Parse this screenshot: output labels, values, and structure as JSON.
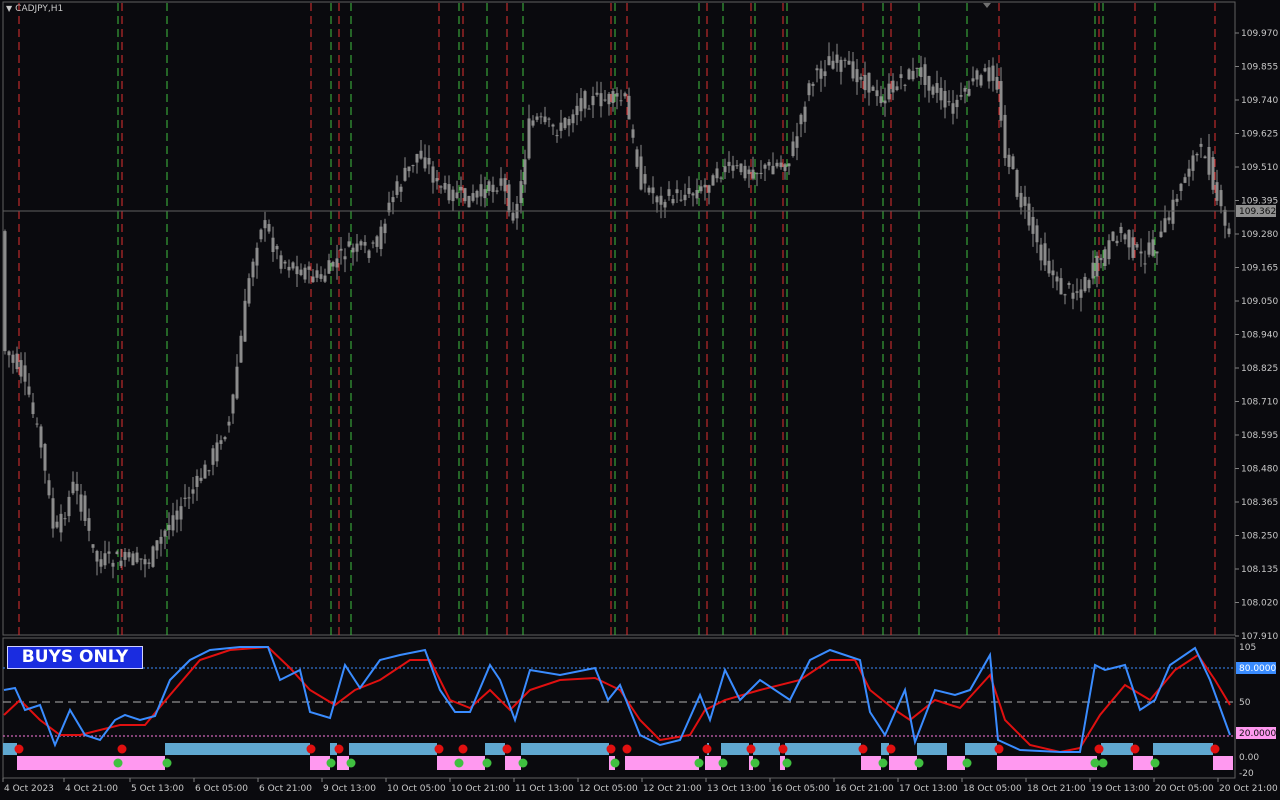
{
  "window": {
    "symbol_title": "CADJPY,H1",
    "dropdown_icon": "triangle-down-icon"
  },
  "price_panel": {
    "price_labels": [
      "109.970",
      "109.855",
      "109.740",
      "109.625",
      "109.510",
      "109.395",
      "109.280",
      "109.165",
      "109.050",
      "108.940",
      "108.825",
      "108.710",
      "108.595",
      "108.480",
      "108.365",
      "108.250",
      "108.135",
      "108.020",
      "107.910"
    ],
    "current_price": "109.362",
    "colors": {
      "candles": "#8c8c8c",
      "current_line": "#606060",
      "sell_line": "#e03030",
      "buy_line": "#40c040"
    }
  },
  "indicator_panel": {
    "badge": "BUYS ONLY",
    "scale_labels": [
      "105",
      "50",
      "0.00",
      "-20"
    ],
    "level_high": "80.0000",
    "level_low": "20.0000",
    "colors": {
      "fast_line": "#3a8cff",
      "slow_line": "#e01010",
      "buy_bar": "#60a8d0",
      "sell_bar": "#ff99f0",
      "buy_dot": "#40c040",
      "sell_dot": "#e01010"
    }
  },
  "time_axis": [
    "4 Oct 2023",
    "4 Oct 21:00",
    "5 Oct 13:00",
    "6 Oct 05:00",
    "6 Oct 21:00",
    "9 Oct 13:00",
    "10 Oct 05:00",
    "10 Oct 21:00",
    "11 Oct 13:00",
    "12 Oct 05:00",
    "12 Oct 21:00",
    "13 Oct 13:00",
    "16 Oct 05:00",
    "16 Oct 21:00",
    "17 Oct 13:00",
    "18 Oct 05:00",
    "18 Oct 21:00",
    "19 Oct 13:00",
    "20 Oct 05:00",
    "20 Oct 21:00"
  ]
}
